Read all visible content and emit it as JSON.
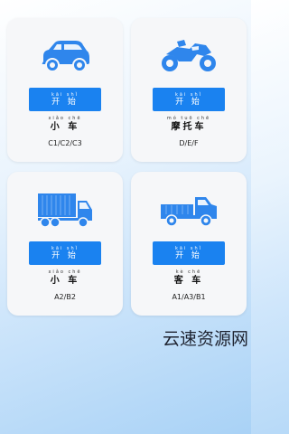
{
  "colors": {
    "accent": "#1a82f0",
    "card": "#f6f7f9"
  },
  "cards": [
    {
      "icon": "car-icon",
      "button_pinyin": "kāi  shǐ",
      "button_label": "开 始",
      "name_pinyin": "xiǎo chē",
      "name": "小 车",
      "license": "C1/C2/C3"
    },
    {
      "icon": "motorcycle-icon",
      "button_pinyin": "kāi  shǐ",
      "button_label": "开 始",
      "name_pinyin": "mó tuō chē",
      "name": "摩托车",
      "license": "D/E/F"
    },
    {
      "icon": "truck-icon",
      "button_pinyin": "kāi  shǐ",
      "button_label": "开 始",
      "name_pinyin": "xiǎo chē",
      "name": "小 车",
      "license": "A2/B2"
    },
    {
      "icon": "pickup-truck-icon",
      "button_pinyin": "kāi  shǐ",
      "button_label": "开 始",
      "name_pinyin": "kè  chē",
      "name": "客 车",
      "license": "A1/A3/B1"
    }
  ],
  "watermark": "云速资源网"
}
